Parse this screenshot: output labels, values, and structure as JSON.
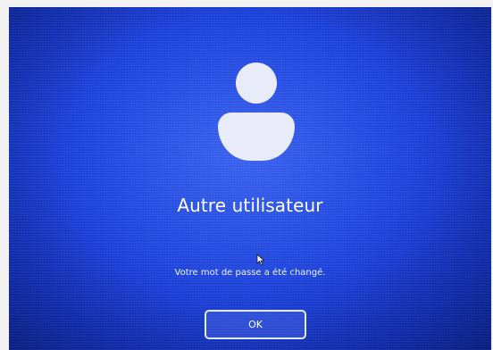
{
  "login_screen": {
    "username": "Autre utilisateur",
    "message": "Votre mot de passe a été changé.",
    "ok_label": "OK",
    "avatar_icon": "user-icon",
    "background_color": "#1f45e0",
    "text_color": "#ffffff"
  }
}
